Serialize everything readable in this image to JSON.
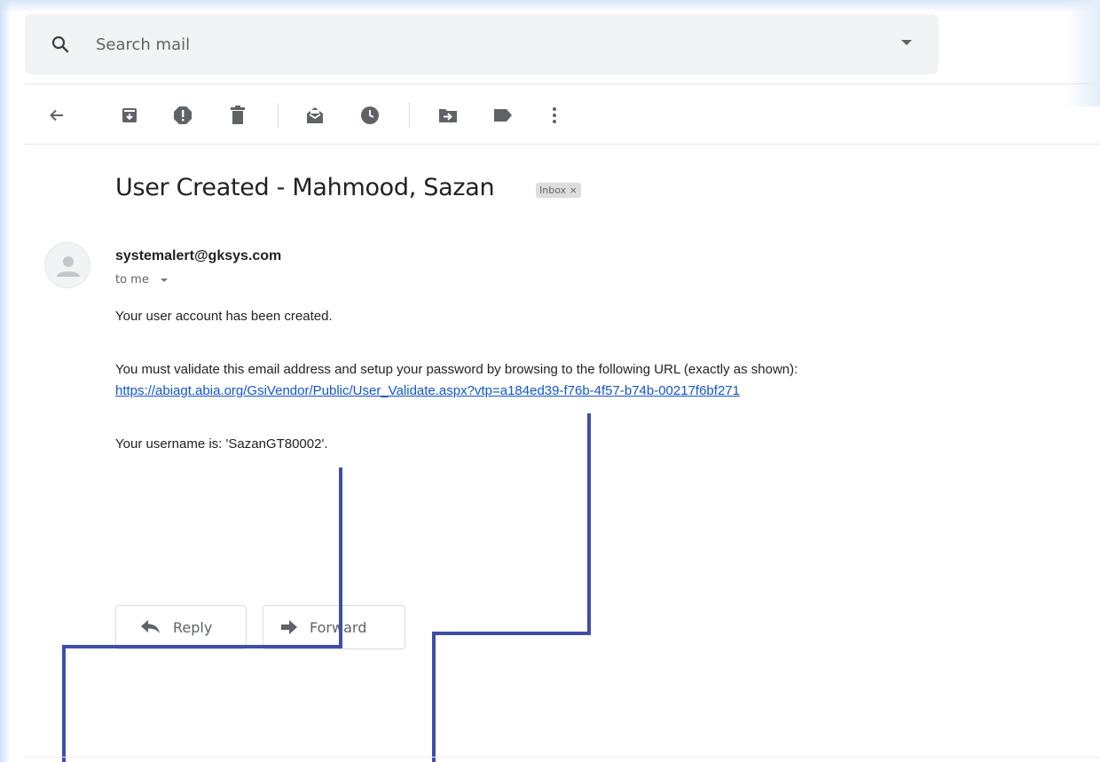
{
  "search": {
    "placeholder": "Search mail"
  },
  "toolbar": {
    "back": "arrow-back-icon",
    "icons": [
      "archive-icon",
      "report-spam-icon",
      "delete-icon",
      "mark-unread-icon",
      "snooze-icon",
      "move-to-icon",
      "label-icon",
      "more-vert-icon"
    ]
  },
  "email": {
    "subject": "User Created - Mahmood, Sazan",
    "label_badge": "Inbox ×",
    "sender": "systemalert@gksys.com",
    "recipient": "to me",
    "body": {
      "line1": "Your user account has been created.",
      "line2": "You must validate this email address and setup your password by browsing to the following URL (exactly as shown):",
      "link": "https://abiagt.abia.org/GsiVendor/Public/User_Validate.aspx?vtp=a184ed39-f76b-4f57-b74b-00217f6bf271",
      "line3": "Your username is: 'SazanGT80002'."
    }
  },
  "actions": {
    "reply": "Reply",
    "forward": "Forward"
  },
  "colors": {
    "link": "#1155cc",
    "annotation": "#3f4ea7",
    "toolbar_icon": "#5f6368"
  }
}
